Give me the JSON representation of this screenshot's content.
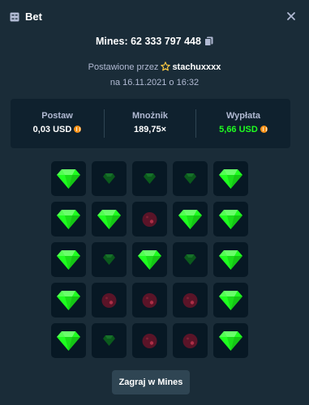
{
  "header": {
    "title": "Bet",
    "icon": "bet-slip-icon",
    "close_icon": "close-icon"
  },
  "bet": {
    "id_label": "Mines: 62 333 797 448",
    "placed_by_prefix": "Postawione przez",
    "username": "stachuxxxx",
    "date": "na 16.11.2021 o 16:32"
  },
  "stats": {
    "bet_label": "Postaw",
    "bet_value": "0,03 USD",
    "multiplier_label": "Mnożnik",
    "multiplier_value": "189,75×",
    "payout_label": "Wypłata",
    "payout_value": "5,66 USD"
  },
  "grid": {
    "rows": [
      [
        "gem",
        "gem-dim",
        "gem-dim",
        "gem-dim",
        "gem"
      ],
      [
        "gem",
        "gem",
        "mine",
        "gem",
        "gem"
      ],
      [
        "gem",
        "gem-dim",
        "gem",
        "gem-dim",
        "gem"
      ],
      [
        "gem",
        "mine",
        "mine",
        "mine",
        "gem"
      ],
      [
        "gem",
        "gem-dim",
        "mine",
        "mine",
        "gem"
      ]
    ]
  },
  "actions": {
    "play_label": "Zagraj w Mines"
  },
  "colors": {
    "background": "#1a2c38",
    "panel": "#0f212e",
    "tile": "#071824",
    "gem": "#1fff20",
    "gem_dim": "#0b5a1d",
    "mine": "#5a1428",
    "payout": "#1fff20",
    "coin": "#f7931a"
  }
}
